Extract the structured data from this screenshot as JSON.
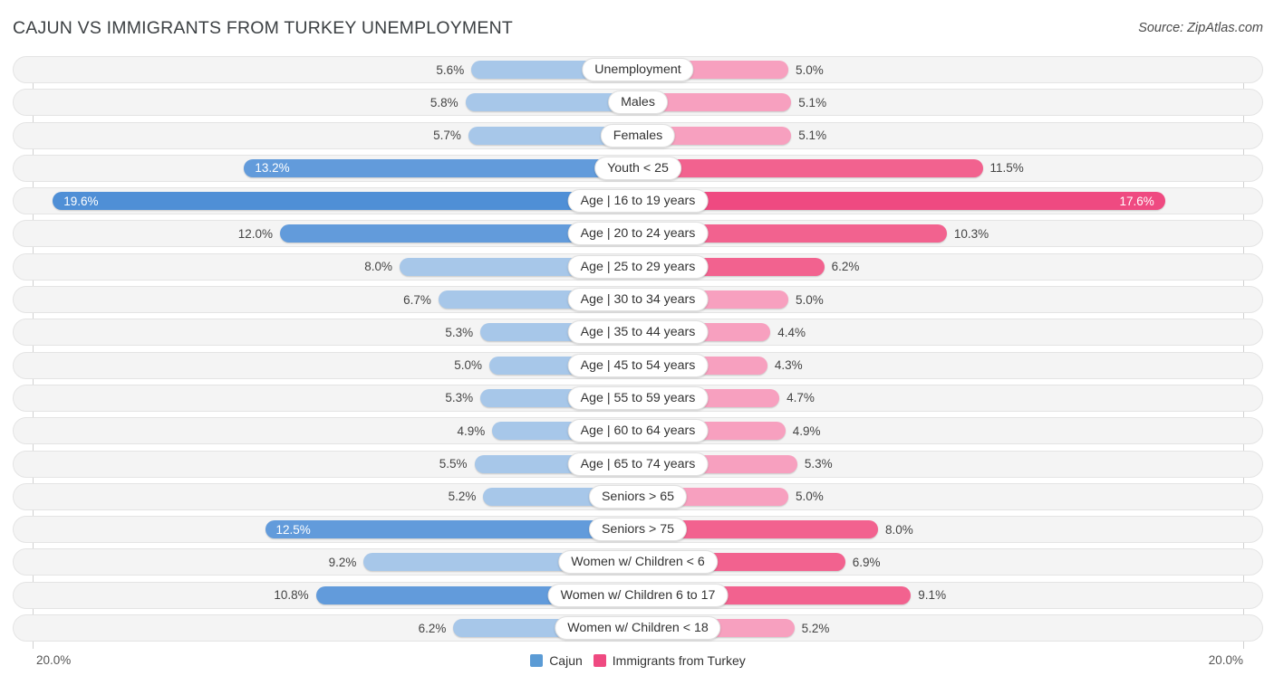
{
  "header": {
    "title": "CAJUN VS IMMIGRANTS FROM TURKEY UNEMPLOYMENT",
    "source": "Source: ZipAtlas.com"
  },
  "axis": {
    "left_label": "20.0%",
    "right_label": "20.0%",
    "max": 20.0
  },
  "legend": {
    "items": [
      {
        "label": "Cajun",
        "color": "#5b9bd5"
      },
      {
        "label": "Immigrants from Turkey",
        "color": "#ef4a81"
      }
    ]
  },
  "colors": {
    "blue_light": "#a7c7e9",
    "blue_mid": "#629bdb",
    "blue_dark": "#4f8fd6",
    "pink_light": "#f7a0bf",
    "pink_mid": "#f2628f",
    "pink_dark": "#ef4a81",
    "row_bg": "#f4f4f4"
  },
  "chart_data": {
    "type": "bar",
    "title": "CAJUN VS IMMIGRANTS FROM TURKEY UNEMPLOYMENT",
    "xlabel": "",
    "ylabel": "",
    "orientation": "horizontal-diverging",
    "xlim": [
      0,
      20.0
    ],
    "grid": false,
    "legend_position": "bottom-center",
    "categories": [
      "Unemployment",
      "Males",
      "Females",
      "Youth < 25",
      "Age | 16 to 19 years",
      "Age | 20 to 24 years",
      "Age | 25 to 29 years",
      "Age | 30 to 34 years",
      "Age | 35 to 44 years",
      "Age | 45 to 54 years",
      "Age | 55 to 59 years",
      "Age | 60 to 64 years",
      "Age | 65 to 74 years",
      "Seniors > 65",
      "Seniors > 75",
      "Women w/ Children < 6",
      "Women w/ Children 6 to 17",
      "Women w/ Children < 18"
    ],
    "series": [
      {
        "name": "Cajun",
        "values": [
          5.6,
          5.8,
          5.7,
          13.2,
          19.6,
          12.0,
          8.0,
          6.7,
          5.3,
          5.0,
          5.3,
          4.9,
          5.5,
          5.2,
          12.5,
          9.2,
          10.8,
          6.2
        ]
      },
      {
        "name": "Immigrants from Turkey",
        "values": [
          5.0,
          5.1,
          5.1,
          11.5,
          17.6,
          10.3,
          6.2,
          5.0,
          4.4,
          4.3,
          4.7,
          4.9,
          5.3,
          5.0,
          8.0,
          6.9,
          9.1,
          5.2
        ]
      }
    ]
  },
  "rows": [
    {
      "label": "Unemployment",
      "left": "5.6%",
      "right": "5.0%",
      "lv": 5.6,
      "rv": 5.0,
      "lshade": "light",
      "rshade": "light",
      "lin": false,
      "rin": false
    },
    {
      "label": "Males",
      "left": "5.8%",
      "right": "5.1%",
      "lv": 5.8,
      "rv": 5.1,
      "lshade": "light",
      "rshade": "light",
      "lin": false,
      "rin": false
    },
    {
      "label": "Females",
      "left": "5.7%",
      "right": "5.1%",
      "lv": 5.7,
      "rv": 5.1,
      "lshade": "light",
      "rshade": "light",
      "lin": false,
      "rin": false
    },
    {
      "label": "Youth < 25",
      "left": "13.2%",
      "right": "11.5%",
      "lv": 13.2,
      "rv": 11.5,
      "lshade": "mid",
      "rshade": "mid",
      "lin": true,
      "rin": false
    },
    {
      "label": "Age | 16 to 19 years",
      "left": "19.6%",
      "right": "17.6%",
      "lv": 19.6,
      "rv": 17.6,
      "lshade": "dark",
      "rshade": "dark",
      "lin": true,
      "rin": true
    },
    {
      "label": "Age | 20 to 24 years",
      "left": "12.0%",
      "right": "10.3%",
      "lv": 12.0,
      "rv": 10.3,
      "lshade": "mid",
      "rshade": "mid",
      "lin": false,
      "rin": false
    },
    {
      "label": "Age | 25 to 29 years",
      "left": "8.0%",
      "right": "6.2%",
      "lv": 8.0,
      "rv": 6.2,
      "lshade": "light",
      "rshade": "mid",
      "lin": false,
      "rin": false
    },
    {
      "label": "Age | 30 to 34 years",
      "left": "6.7%",
      "right": "5.0%",
      "lv": 6.7,
      "rv": 5.0,
      "lshade": "light",
      "rshade": "light",
      "lin": false,
      "rin": false
    },
    {
      "label": "Age | 35 to 44 years",
      "left": "5.3%",
      "right": "4.4%",
      "lv": 5.3,
      "rv": 4.4,
      "lshade": "light",
      "rshade": "light",
      "lin": false,
      "rin": false
    },
    {
      "label": "Age | 45 to 54 years",
      "left": "5.0%",
      "right": "4.3%",
      "lv": 5.0,
      "rv": 4.3,
      "lshade": "light",
      "rshade": "light",
      "lin": false,
      "rin": false
    },
    {
      "label": "Age | 55 to 59 years",
      "left": "5.3%",
      "right": "4.7%",
      "lv": 5.3,
      "rv": 4.7,
      "lshade": "light",
      "rshade": "light",
      "lin": false,
      "rin": false
    },
    {
      "label": "Age | 60 to 64 years",
      "left": "4.9%",
      "right": "4.9%",
      "lv": 4.9,
      "rv": 4.9,
      "lshade": "light",
      "rshade": "light",
      "lin": false,
      "rin": false
    },
    {
      "label": "Age | 65 to 74 years",
      "left": "5.5%",
      "right": "5.3%",
      "lv": 5.5,
      "rv": 5.3,
      "lshade": "light",
      "rshade": "light",
      "lin": false,
      "rin": false
    },
    {
      "label": "Seniors > 65",
      "left": "5.2%",
      "right": "5.0%",
      "lv": 5.2,
      "rv": 5.0,
      "lshade": "light",
      "rshade": "light",
      "lin": false,
      "rin": false
    },
    {
      "label": "Seniors > 75",
      "left": "12.5%",
      "right": "8.0%",
      "lv": 12.5,
      "rv": 8.0,
      "lshade": "mid",
      "rshade": "mid",
      "lin": true,
      "rin": false
    },
    {
      "label": "Women w/ Children < 6",
      "left": "9.2%",
      "right": "6.9%",
      "lv": 9.2,
      "rv": 6.9,
      "lshade": "light",
      "rshade": "mid",
      "lin": false,
      "rin": false
    },
    {
      "label": "Women w/ Children 6 to 17",
      "left": "10.8%",
      "right": "9.1%",
      "lv": 10.8,
      "rv": 9.1,
      "lshade": "mid",
      "rshade": "mid",
      "lin": false,
      "rin": false
    },
    {
      "label": "Women w/ Children < 18",
      "left": "6.2%",
      "right": "5.2%",
      "lv": 6.2,
      "rv": 5.2,
      "lshade": "light",
      "rshade": "light",
      "lin": false,
      "rin": false
    }
  ]
}
